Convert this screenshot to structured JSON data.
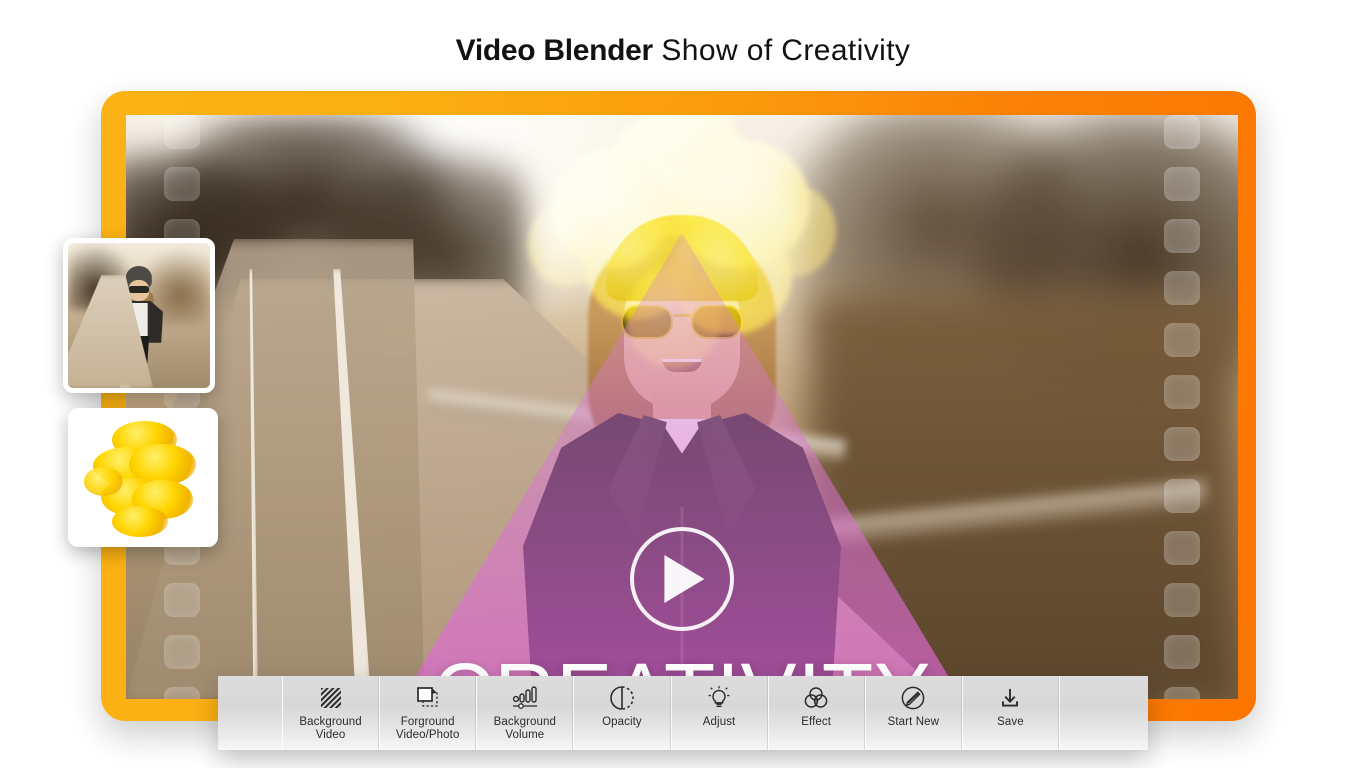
{
  "header": {
    "title_bold": "Video Blender",
    "title_rest": "Show of  Creativity"
  },
  "video": {
    "caption": "CREATIVITY",
    "play_icon": "play-icon",
    "frame_color_start": "#fbb215",
    "frame_color_end": "#fb7500",
    "overlay_triangle_color": "#e268d6",
    "ink_color": "#ffd200"
  },
  "thumbnails": [
    {
      "name": "background-video-thumbnail",
      "kind": "road-photo"
    },
    {
      "name": "foreground-video-thumbnail",
      "kind": "yellow-ink-photo"
    }
  ],
  "toolbar": {
    "items": [
      {
        "icon": "hatched-square-icon",
        "line1": "Background",
        "line2": "Video"
      },
      {
        "icon": "layers-copy-icon",
        "line1": "Forground",
        "line2": "Video/Photo"
      },
      {
        "icon": "volume-bars-icon",
        "line1": "Background",
        "line2": "Volume"
      },
      {
        "icon": "opacity-circle-icon",
        "line1": "Opacity",
        "line2": ""
      },
      {
        "icon": "lightbulb-icon",
        "line1": "Adjust",
        "line2": ""
      },
      {
        "icon": "venn-circles-icon",
        "line1": "Effect",
        "line2": ""
      },
      {
        "icon": "pencil-circle-icon",
        "line1": "Start New",
        "line2": ""
      },
      {
        "icon": "download-icon",
        "line1": "Save",
        "line2": ""
      }
    ]
  }
}
